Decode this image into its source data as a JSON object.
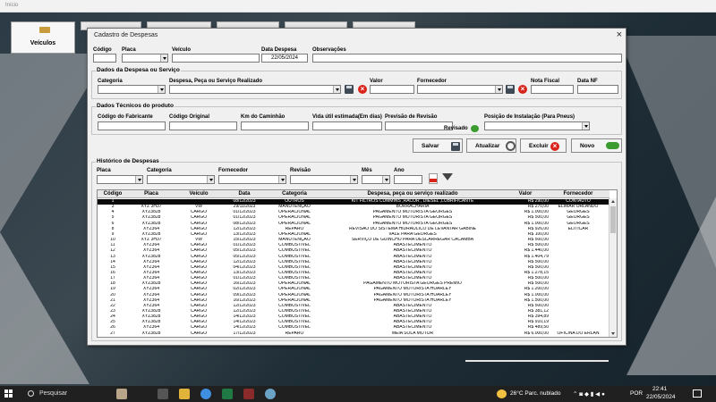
{
  "top_bar": {
    "title": "Início"
  },
  "main_nav": {
    "veiculos_label": "Veículos"
  },
  "dialog": {
    "title": "Cadastro de Despesas",
    "close": "×",
    "header_fields": {
      "codigo_label": "Código",
      "codigo_value": "",
      "placa_label": "Placa",
      "placa_value": "",
      "veiculo_label": "Veículo",
      "veiculo_value": "",
      "data_despesa_label": "Data Despesa",
      "data_despesa_value": "22/05/2024",
      "observacoes_label": "Observações",
      "observacoes_value": ""
    },
    "dados_despesa": {
      "title": "Dados da Despesa ou Serviço",
      "categoria_label": "Categoria",
      "despesa_label": "Despesa, Peça ou Serviço Realizado",
      "valor_label": "Valor",
      "fornecedor_label": "Fornecedor",
      "nota_fiscal_label": "Nota Fiscal",
      "data_nf_label": "Data NF"
    },
    "dados_tecnicos": {
      "title": "Dados Técnicos do produto",
      "codigo_fabricante_label": "Código do Fabricante",
      "codigo_original_label": "Código Original",
      "km_label": "Km do Caminhão",
      "vida_util_label": "Vida útil estimada(Em dias)",
      "previsao_label": "Previsão de Revisão",
      "revisado_label": "Revisado",
      "posicao_label": "Posição de Instalação (Para Pneus)"
    },
    "buttons": {
      "salvar": "Salvar",
      "atualizar": "Atualizar",
      "excluir": "Excluir",
      "novo": "Novo"
    },
    "historico": {
      "title": "Histórico de Despesas",
      "filters": {
        "placa_label": "Placa",
        "categoria_label": "Categoria",
        "fornecedor_label": "Fornecedor",
        "revisao_label": "Revisão",
        "mes_label": "Mês",
        "ano_label": "Ano"
      },
      "columns": [
        "Código",
        "Placa",
        "Veículo",
        "Data",
        "Categoria",
        "Despesa, peça ou serviço realizado",
        "Valor",
        "Fornecedor"
      ],
      "rows": [
        [
          "1",
          "",
          "",
          "08/12/2023",
          "OUTROS",
          "KIT FILTROS CUMMINS ,RACOR , DIESEL ,LUBRIFICANTE",
          "R$ 290,00",
          "CONTAUTO"
        ],
        [
          "3",
          "XYZ 3H37",
          "VW",
          "29/11/2023",
          "MANUTENÇÃO",
          "BORRACHARIA",
          "R$ 270,00",
          "ELIMAR ORLANDO"
        ],
        [
          "4",
          "XYZ3828",
          "CARGO",
          "01/12/2023",
          "OPERACIONAL",
          "PAGAMENTO MOTORISTA GEORGES",
          "R$ 1.000,00",
          "GEORGES"
        ],
        [
          "5",
          "XYZ3828",
          "CARGO",
          "01/12/2023",
          "OPERACIONAL",
          "PAGAMENTO MOTORISTA GEORGES",
          "R$ 500,00",
          "GEORGES"
        ],
        [
          "6",
          "XYZ3828",
          "CARGO",
          "08/12/2023",
          "OPERACIONAL",
          "PAGAMENTO MOTORISTA GEORGES",
          "R$ 1.000,00",
          "GEORGES"
        ],
        [
          "8",
          "XYZ364",
          "CARGO",
          "12/12/2023",
          "REPARO",
          "REVISAO DO SISTEMA HIDRAULICO DE LEVANTAR GABINE",
          "R$ 926,00",
          "ELITICAR"
        ],
        [
          "9",
          "XYZ3828",
          "CARGO",
          "13/12/2023",
          "OPERACIONAL",
          "VALE PARA GEORGES",
          "R$ 100,00",
          ""
        ],
        [
          "10",
          "XYZ 3H37",
          "VW",
          "15/12/2023",
          "MANUTENÇÃO",
          "SERVIÇO DE GUINCHO PARA DESCARREGAR CACAMBA",
          "R$ 500,00",
          ""
        ],
        [
          "11",
          "XYZ364",
          "CARGO",
          "01/12/2023",
          "COMBUSTIVEL",
          "ABASTECIMENTO",
          "R$ 500,00",
          ""
        ],
        [
          "12",
          "XYZ364",
          "CARGO",
          "05/12/2023",
          "COMBUSTIVEL",
          "ABASTECIMENTO",
          "R$ 1.440,00",
          ""
        ],
        [
          "13",
          "XYZ3828",
          "CARGO",
          "05/12/2023",
          "COMBUSTIVEL",
          "ABASTECIMENTO",
          "R$ 1.404,79",
          ""
        ],
        [
          "14",
          "XYZ364",
          "CARGO",
          "12/12/2023",
          "COMBUSTIVEL",
          "ABASTECIMENTO",
          "R$ 500,00",
          ""
        ],
        [
          "15",
          "XYZ364",
          "CARGO",
          "04/12/2023",
          "COMBUSTIVEL",
          "ABASTECIMENTO",
          "R$ 500,00",
          ""
        ],
        [
          "16",
          "XYZ364",
          "CARGO",
          "13/12/2023",
          "COMBUSTIVEL",
          "ABASTECIMENTO",
          "R$ 1.278,15",
          ""
        ],
        [
          "17",
          "XYZ364",
          "CARGO",
          "01/12/2023",
          "COMBUSTIVEL",
          "ABASTECIMENTO",
          "R$ 500,00",
          ""
        ],
        [
          "18",
          "XYZ3828",
          "CARGO",
          "16/12/2023",
          "OPERACIONAL",
          "PAGAMENTO MOTORISTA GEORGES PREMIO",
          "R$ 500,00",
          ""
        ],
        [
          "19",
          "XYZ364",
          "CARGO",
          "02/12/2023",
          "OPERACIONAL",
          "PAGAMENTO MOTORISTA HUARLEY",
          "R$ 1.200,00",
          ""
        ],
        [
          "20",
          "XYZ364",
          "CARGO",
          "09/12/2023",
          "OPERACIONAL",
          "PAGAMENTO MOTORISTA HUARLEY",
          "R$ 1.000,00",
          ""
        ],
        [
          "21",
          "XYZ364",
          "CARGO",
          "16/12/2023",
          "OPERACIONAL",
          "PAGAMENTO MOTORISTA HUARLEY",
          "R$ 1.500,00",
          ""
        ],
        [
          "22",
          "XYZ364",
          "CARGO",
          "12/12/2023",
          "COMBUSTIVEL",
          "ABASTECIMENTO",
          "R$ 500,00",
          ""
        ],
        [
          "23",
          "XYZ3828",
          "CARGO",
          "12/12/2023",
          "COMBUSTIVEL",
          "ABASTECIMENTO",
          "R$ 381,12",
          ""
        ],
        [
          "24",
          "XYZ3828",
          "CARGO",
          "14/12/2023",
          "COMBUSTIVEL",
          "ABASTECIMENTO",
          "R$ 394,89",
          ""
        ],
        [
          "25",
          "XYZ3828",
          "CARGO",
          "14/12/2023",
          "COMBUSTIVEL",
          "ABASTECIMENTO",
          "R$ 910,19",
          ""
        ],
        [
          "26",
          "XYZ364",
          "CARGO",
          "14/12/2023",
          "COMBUSTIVEL",
          "ABASTECIMENTO",
          "R$ 489,50",
          ""
        ],
        [
          "27",
          "XYZ3828",
          "CARGO",
          "17/12/2023",
          "REPARO",
          "MEIA SOLA MOTOR",
          "R$ 6.000,00",
          "OFICINA DO ERLAN"
        ]
      ],
      "selected_row": 0
    }
  },
  "taskbar": {
    "search_placeholder": "Pesquisar",
    "weather": "26°C  Parc. nublado",
    "language": "POR",
    "time": "22:41",
    "date": "22/05/2024"
  },
  "colors": {
    "accent_red": "#d9241b",
    "accent_green": "#3a9b2f",
    "selection": "#0a0a0a"
  }
}
